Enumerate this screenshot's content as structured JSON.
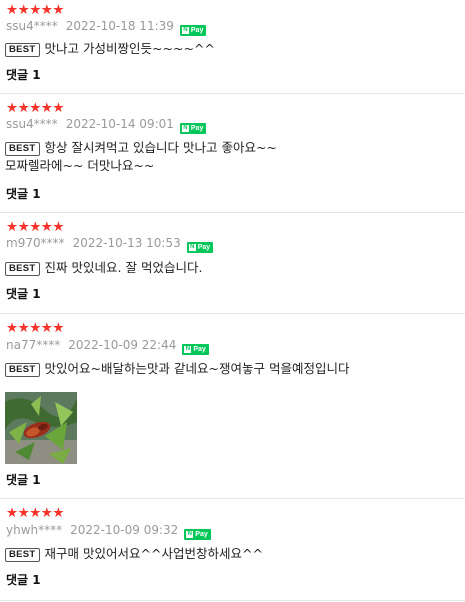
{
  "reviews": [
    {
      "stars": "★★★★★",
      "user": "ssu4****",
      "date": "2022-10-18 11:39",
      "pay": "Pay",
      "badge": "BEST",
      "line1": "맛나고 가성비짱인듯~~~~^^",
      "line2": "",
      "comment": "댓글 1",
      "rating": 5
    },
    {
      "stars": "★★★★★",
      "user": "ssu4****",
      "date": "2022-10-14 09:01",
      "pay": "Pay",
      "badge": "BEST",
      "line1": "항상 잘시켜먹고 있습니다 맛나고 좋아요~~",
      "line2": "모짜렐라에~~ 더맛나요~~",
      "comment": "댓글 1",
      "rating": 5
    },
    {
      "stars": "★★★★★",
      "user": "m970****",
      "date": "2022-10-13 10:53",
      "pay": "Pay",
      "badge": "BEST",
      "line1": "진짜 맛있네요. 잘 먹었습니다.",
      "line2": "",
      "comment": "댓글 1",
      "rating": 5
    },
    {
      "stars": "★★★★★",
      "user": "na77****",
      "date": "2022-10-09 22:44",
      "pay": "Pay",
      "badge": "BEST",
      "line1": "맛있어요~배달하는맛과 같네요~쟁여놓구 먹을예정입니다",
      "line2": "",
      "comment": "댓글 1",
      "rating": 5
    },
    {
      "stars": "★★★★★",
      "user": "yhwh****",
      "date": "2022-10-09 09:32",
      "pay": "Pay",
      "badge": "BEST",
      "line1": "재구매 맛있어서요^^사업번창하세요^^",
      "line2": "",
      "comment": "댓글 1",
      "rating": 5
    }
  ],
  "npay_letter": "N",
  "colors": {
    "star": "#f5342c",
    "npay": "#03c75a",
    "meta": "#9a9a9a"
  }
}
